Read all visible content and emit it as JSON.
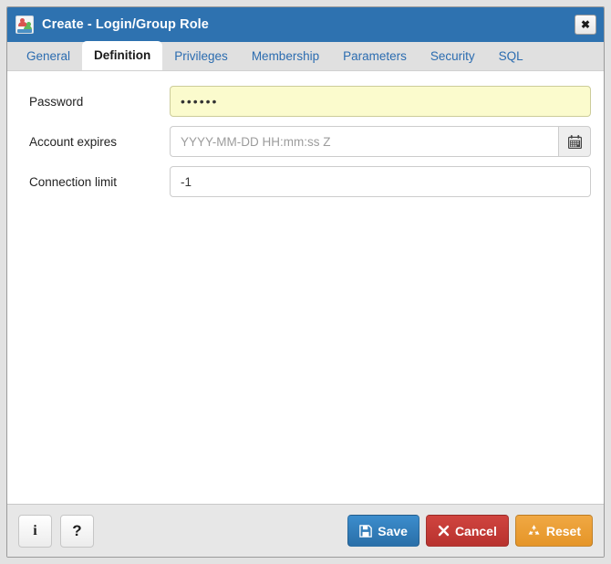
{
  "window": {
    "title": "Create - Login/Group Role",
    "icon": "login-group-role-icon",
    "close_label": "✖"
  },
  "tabs": [
    {
      "label": "General",
      "active": false
    },
    {
      "label": "Definition",
      "active": true
    },
    {
      "label": "Privileges",
      "active": false
    },
    {
      "label": "Membership",
      "active": false
    },
    {
      "label": "Parameters",
      "active": false
    },
    {
      "label": "Security",
      "active": false
    },
    {
      "label": "SQL",
      "active": false
    }
  ],
  "form": {
    "fields": [
      {
        "label": "Password",
        "value": "••••••",
        "placeholder": "",
        "highlight": true
      },
      {
        "label": "Account expires",
        "value": "",
        "placeholder": "YYYY-MM-DD HH:mm:ss Z",
        "addon_icon": "calendar-icon"
      },
      {
        "label": "Connection limit",
        "value": "-1",
        "placeholder": ""
      }
    ]
  },
  "footer": {
    "info_label": "i",
    "help_label": "?",
    "save_label": "Save",
    "cancel_label": "Cancel",
    "reset_label": "Reset"
  },
  "colors": {
    "titlebar": "#2e72b0",
    "tab_text": "#2b6cb0",
    "tabstrip_bg": "#e0e0e0",
    "password_field_bg": "#fbfbcd",
    "save": "#2a6fa8",
    "cancel": "#b8322e",
    "reset": "#e59528",
    "footer_bg": "#e7e7e7"
  }
}
